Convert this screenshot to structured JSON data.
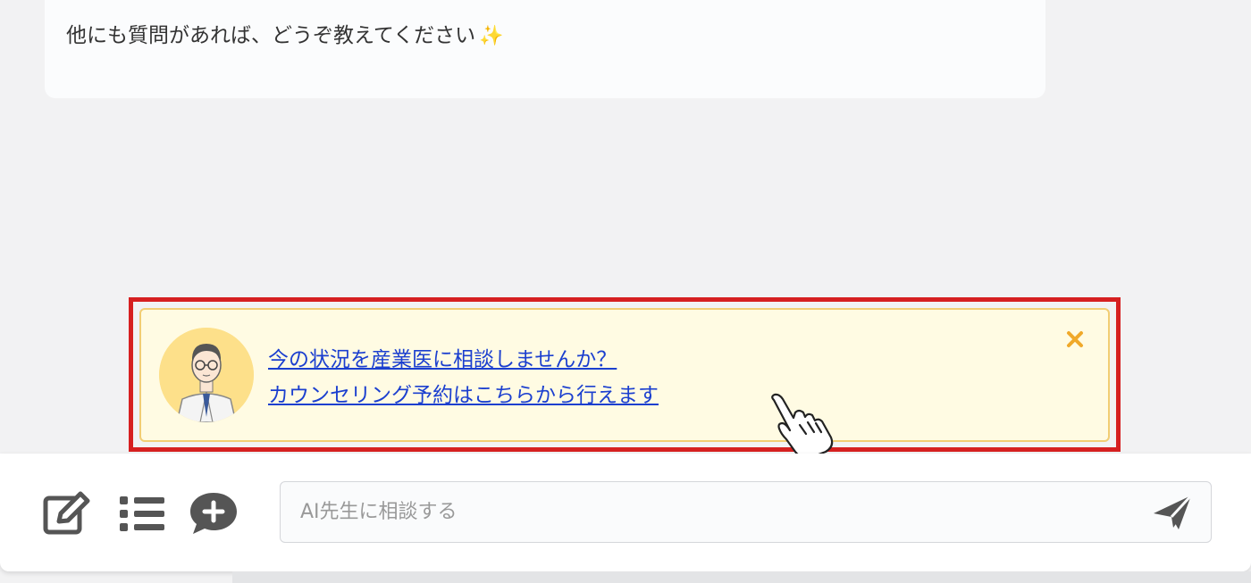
{
  "message": {
    "text": "他にも質問があれば、どうぞ教えてください",
    "emoji": "✨"
  },
  "banner": {
    "line1": "今の状況を産業医に相談しませんか？",
    "line2": "カウンセリング予約はこちらから行えます",
    "avatar_icon": "doctor-avatar",
    "close_icon": "close-icon",
    "highlight_color": "#d62020",
    "close_color": "#f0a92a"
  },
  "toolbar": {
    "icons": [
      "edit-icon",
      "list-icon",
      "add-comment-icon"
    ]
  },
  "composer": {
    "placeholder": "AI先生に相談する",
    "send_icon": "send-icon"
  }
}
